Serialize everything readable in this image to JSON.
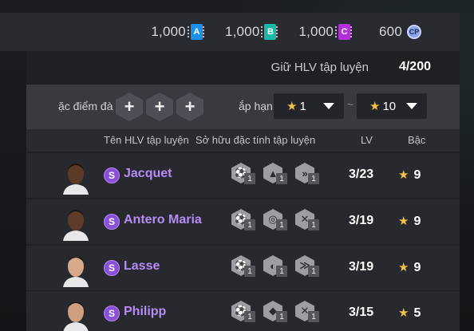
{
  "currency": [
    {
      "value": "1,000",
      "badge": "A",
      "color": "#1e8fe8"
    },
    {
      "value": "1,000",
      "badge": "B",
      "color": "#18b9a6"
    },
    {
      "value": "1,000",
      "badge": "C",
      "color": "#b131d8"
    },
    {
      "value": "600",
      "badge": "CP",
      "color": "#8aa6f0"
    }
  ],
  "coach_count": {
    "label": "Giữ HLV tập luyện",
    "value": "4/200"
  },
  "filter": {
    "traits_label": "ặc điểm đà",
    "trait_slots": [
      "+",
      "+",
      "+"
    ],
    "sort_label": "ắp hạn",
    "min_star": "1",
    "max_star": "10",
    "separator": "~",
    "star_glyph": "★"
  },
  "columns": {
    "name": "Tên HLV tập luyện",
    "traits": "Sở hữu đặc tính tập luyện",
    "lv": "LV",
    "grade": "Bậc"
  },
  "coaches": [
    {
      "rank_badge": "S",
      "name": "Jacquet",
      "traits": [
        {
          "icon": "kick-icon",
          "level": "1"
        },
        {
          "icon": "header-icon",
          "level": "1"
        },
        {
          "icon": "sprint-icon",
          "level": "1"
        }
      ],
      "lv": "3/23",
      "grade": "9",
      "skin": "#5b3a26"
    },
    {
      "rank_badge": "S",
      "name": "Antero Maria",
      "traits": [
        {
          "icon": "kick-icon",
          "level": "1"
        },
        {
          "icon": "shot-icon",
          "level": "1"
        },
        {
          "icon": "tackle-icon",
          "level": "1"
        }
      ],
      "lv": "3/19",
      "grade": "9",
      "skin": "#5e3c28"
    },
    {
      "rank_badge": "S",
      "name": "Lasse",
      "traits": [
        {
          "icon": "kick-icon",
          "level": "1"
        },
        {
          "icon": "chip-icon",
          "level": "1"
        },
        {
          "icon": "speed-icon",
          "level": "1"
        }
      ],
      "lv": "3/19",
      "grade": "9",
      "skin": "#d6a98a"
    },
    {
      "rank_badge": "S",
      "name": "Philipp",
      "traits": [
        {
          "icon": "kick-icon",
          "level": "1"
        },
        {
          "icon": "dribble-icon",
          "level": "1"
        },
        {
          "icon": "tackle-icon",
          "level": "1"
        }
      ],
      "lv": "3/15",
      "grade": "5",
      "skin": "#cf9f82"
    }
  ]
}
